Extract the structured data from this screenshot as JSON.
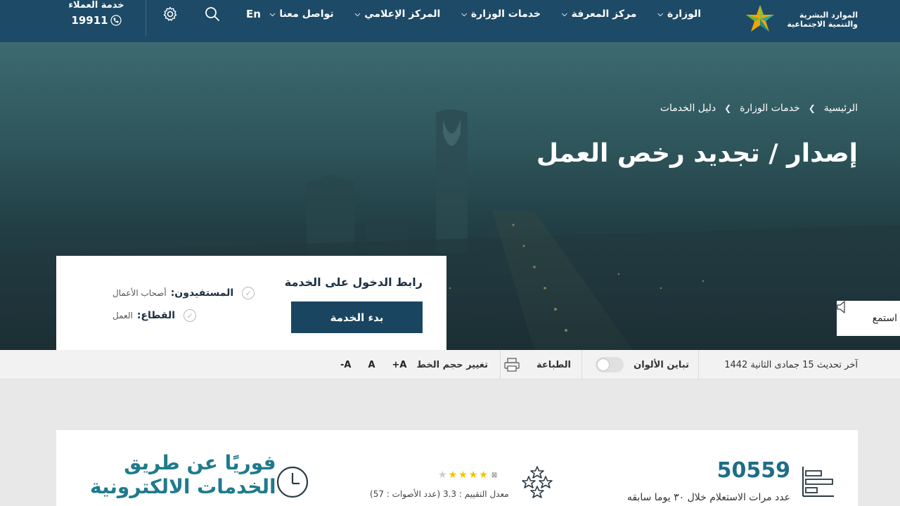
{
  "header": {
    "logo_line1": "الموارد البشرية",
    "logo_line2": "والتنمية الاجتماعية",
    "nav": [
      "الوزارة",
      "مركز المعرفة",
      "خدمات الوزارة",
      "المركز الإعلامي",
      "تواصل معنا"
    ],
    "lang": "En",
    "customer_service_title": "خدمة العملاء",
    "customer_service_number": "19911"
  },
  "breadcrumb": {
    "home": "الرئيسية",
    "services": "خدمات الوزارة",
    "guide": "دليل الخدمات"
  },
  "page_title": "إصدار / تجديد رخص العمل",
  "service_card": {
    "link_title": "رابط الدخول على الخدمة",
    "start_button": "بدء الخدمة",
    "beneficiaries_key": "المستفيدون:",
    "beneficiaries_value": "أصحاب الأعمال",
    "sector_key": "القطاع:",
    "sector_value": "العمل"
  },
  "listen": "استمع",
  "toolbar": {
    "last_update": "آخر تحديث 15 جمادى الثانية 1442",
    "contrast": "تباين الألوان",
    "print": "الطباعة",
    "font_size": "تغيير حجم الخط",
    "font_plus": "A+",
    "font_normal": "A",
    "font_minus": "A-"
  },
  "stats": {
    "count": "50559",
    "count_label": "عدد مرات الاستعلام خلال ٣٠ يوما سابقه",
    "rating_text": "معدل التقييم : 3.3 (عدد الأصوات : 57)",
    "rating_value": 3.3,
    "instant_line1": "فوريًا عن طريق",
    "instant_line2": "الخدمات الالكترونية"
  },
  "colors": {
    "header_bg": "#1d4a66",
    "button_bg": "#1a4560",
    "accent_teal": "#1f7a8c",
    "star": "#f2c200"
  }
}
